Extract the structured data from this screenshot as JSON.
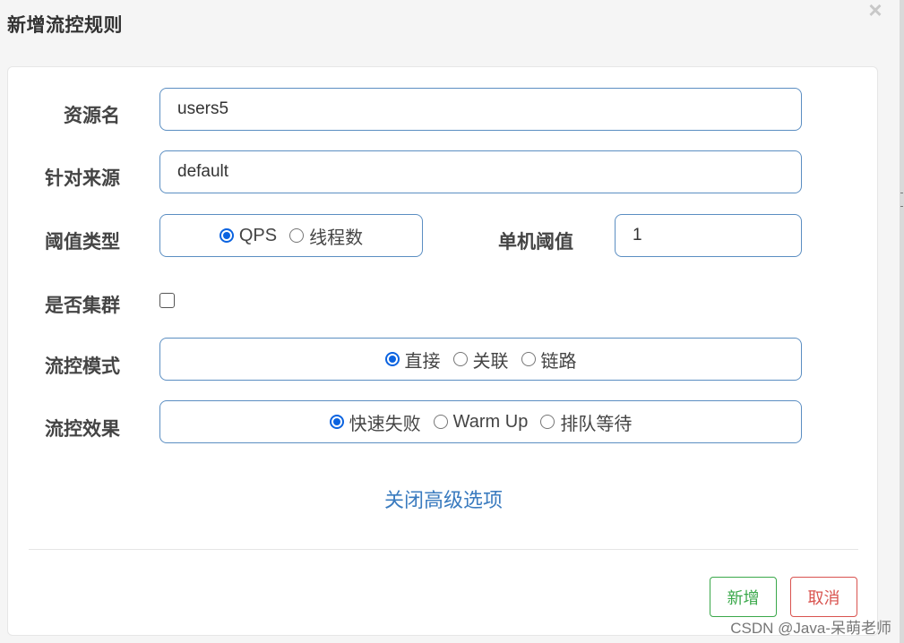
{
  "dialog": {
    "title": "新增流控规则",
    "close_symbol": "×"
  },
  "form": {
    "resource_name": {
      "label": "资源名",
      "value": "users5"
    },
    "limit_app": {
      "label": "针对来源",
      "value": "default"
    },
    "threshold_type": {
      "label": "阈值类型",
      "options": [
        "QPS",
        "线程数"
      ],
      "selected": "QPS"
    },
    "single_threshold": {
      "label": "单机阈值",
      "value": "1"
    },
    "cluster_mode": {
      "label": "是否集群",
      "checked": false
    },
    "control_mode": {
      "label": "流控模式",
      "options": [
        "直接",
        "关联",
        "链路"
      ],
      "selected": "直接"
    },
    "control_effect": {
      "label": "流控效果",
      "options": [
        "快速失败",
        "Warm Up",
        "排队等待"
      ],
      "selected": "快速失败"
    },
    "advanced_toggle": "关闭高级选项"
  },
  "footer": {
    "add_label": "新增",
    "cancel_label": "取消"
  },
  "watermark": "CSDN @Java-呆萌老师",
  "colors": {
    "accent": "#3a7bbf",
    "field_border": "#5b8ec2",
    "radio_checked": "#0b63e0",
    "add_button": "#3aa84a",
    "cancel_button": "#d9534f"
  }
}
